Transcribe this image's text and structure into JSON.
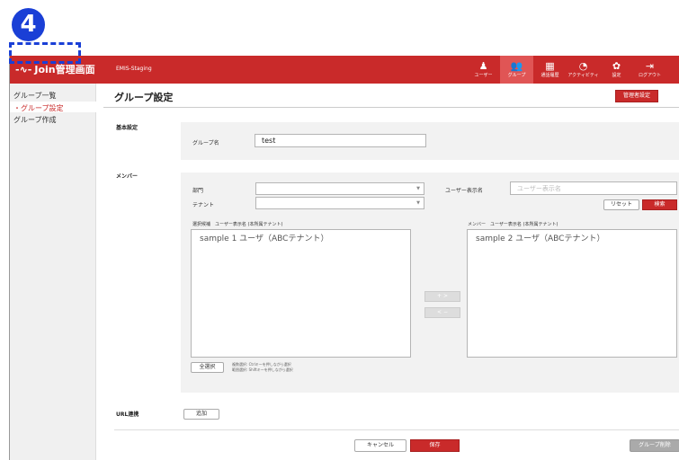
{
  "step_badge": "4",
  "header": {
    "app_name": "Join管理画面",
    "env": "EMIS-Staging",
    "nav": [
      {
        "label": "ユーザー",
        "icon": "user-icon",
        "glyph": "♟",
        "active": false
      },
      {
        "label": "グループ",
        "icon": "group-icon",
        "glyph": "👥",
        "active": true
      },
      {
        "label": "通話履歴",
        "icon": "calendar-icon",
        "glyph": "▦",
        "active": false
      },
      {
        "label": "アクティビティ",
        "icon": "activity-icon",
        "glyph": "◔",
        "active": false
      },
      {
        "label": "設定",
        "icon": "gear-icon",
        "glyph": "✿",
        "active": false
      },
      {
        "label": "ログアウト",
        "icon": "logout-icon",
        "glyph": "⇥",
        "active": false
      }
    ]
  },
  "sidebar": {
    "items": [
      {
        "label": "グループ一覧"
      },
      {
        "label": "・グループ設定"
      },
      {
        "label": "グループ作成"
      }
    ]
  },
  "page": {
    "title": "グループ設定",
    "admin_button": "管理者設定"
  },
  "basic": {
    "section_label": "基本設定",
    "group_name_label": "グループ名",
    "group_name_value": "test"
  },
  "member": {
    "section_label": "メンバー",
    "dept_label": "部門",
    "tenant_label": "テナント",
    "display_name_label": "ユーザー表示名",
    "display_name_placeholder": "ユーザー表示名",
    "reset_button": "リセット",
    "search_button": "検索",
    "candidates_header": "選択候補　ユーザー表示名 (本所属テナント)",
    "candidates": [
      "sample 1 ユーザ（ABCテナント）"
    ],
    "members_header": "メンバー　ユーザー表示名 (本所属テナント)",
    "members": [
      "sample 2 ユーザ（ABCテナント）"
    ],
    "add_arrow": "+ >",
    "remove_arrow": "< −",
    "select_all_button": "全選択",
    "note_line1": "複数選択: Ctrlキーを押しながら選択",
    "note_line2": "範囲選択: Shiftキーを押しながら選択"
  },
  "url": {
    "section_label": "URL連携",
    "add_button": "追加"
  },
  "footer": {
    "cancel_button": "キャンセル",
    "save_button": "保存",
    "delete_button": "グループ削除"
  },
  "colors": {
    "brand": "#c92a2a",
    "highlight": "#1a3fd6"
  }
}
